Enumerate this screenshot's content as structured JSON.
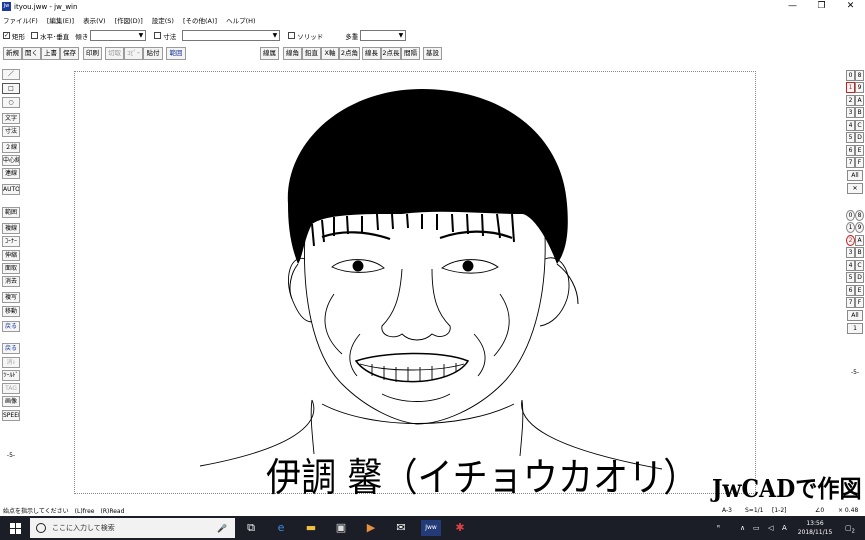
{
  "window": {
    "title": "ityou.jww - jw_win",
    "app_icon": "Jw",
    "controls": [
      "—",
      "❐",
      "✕"
    ]
  },
  "menu": [
    "ファイル(F)",
    "[編集(E)]",
    "表示(V)",
    "[作図(D)]",
    "設定(S)",
    "[その他(A)]",
    "ヘルプ(H)"
  ],
  "toolbar1": {
    "rect_label": "矩形",
    "rect_checked": true,
    "hv_label": "水平･垂直",
    "tilt_label": "傾き",
    "tilt_value": "",
    "dim_label": "寸法",
    "dim_value": "",
    "solid_label": "ソリッド",
    "multi_label": "多重",
    "multi_value": ""
  },
  "toolbar2": [
    "新規",
    "開く",
    "上書",
    "保存",
    "印刷",
    "切取",
    "ｺﾋﾟｰ",
    "貼付",
    "範囲",
    "線属",
    "線角",
    "鉛直",
    "X軸",
    "2点角",
    "線長",
    "2点長",
    "間隔",
    "基設"
  ],
  "left_tools": [
    "／",
    "□",
    "○",
    "文字",
    "寸法",
    "２線",
    "中心線",
    "連線",
    "AUTO",
    "範囲",
    "複線",
    "ｺｰﾅｰ",
    "伸縮",
    "面取",
    "消去",
    "複写",
    "移動",
    "戻る",
    "戻る",
    "消ﾚ",
    "ﾂｰﾙﾄﾞ",
    "TAG",
    "画像",
    "SPEED",
    "-5-"
  ],
  "right_layers_top": [
    "0",
    "8",
    "1",
    "9",
    "2",
    "A",
    "3",
    "B",
    "4",
    "C",
    "5",
    "D",
    "6",
    "E",
    "7",
    "F",
    "All",
    "✕"
  ],
  "right_layers_bottom": [
    "0",
    "8",
    "1",
    "9",
    "2",
    "A",
    "3",
    "B",
    "4",
    "C",
    "5",
    "D",
    "6",
    "E",
    "7",
    "F",
    "All",
    "1",
    "-5-"
  ],
  "canvas": {
    "caption": "伊調 馨（イチョウカオリ）",
    "watermark": "JwCADで作図"
  },
  "status": {
    "message": "始点を指示してください　(L)free　(R)Read",
    "paper": "A-3",
    "scale": "S=1/1",
    "layer": "[1-2]",
    "angle": "∠0",
    "ratio": "× 0.48"
  },
  "taskbar": {
    "search_placeholder": "ここに入力して検索",
    "ime": "A",
    "time": "13:56",
    "date": "2018/11/15",
    "notif_count": "2"
  }
}
